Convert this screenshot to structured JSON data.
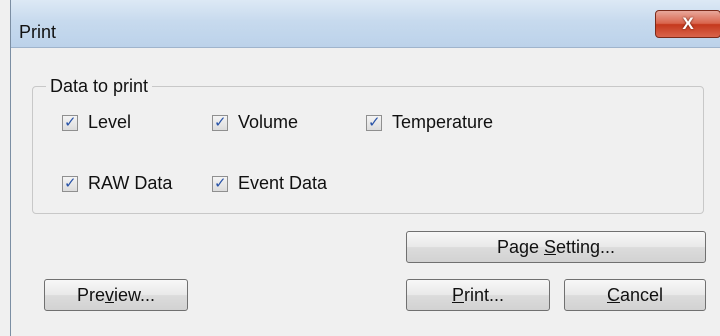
{
  "window": {
    "title": "Print",
    "close_label": "X"
  },
  "group": {
    "legend": "Data to print",
    "checkboxes": [
      {
        "label": "Level",
        "checked": true
      },
      {
        "label": "Volume",
        "checked": true
      },
      {
        "label": "Temperature",
        "checked": true
      },
      {
        "label": "RAW Data",
        "checked": true
      },
      {
        "label": "Event Data",
        "checked": true
      }
    ]
  },
  "buttons": {
    "page_setting": {
      "pre": "Page ",
      "mnemonic": "S",
      "post": "etting..."
    },
    "preview": {
      "pre": "Pre",
      "mnemonic": "v",
      "post": "iew..."
    },
    "print": {
      "pre": "",
      "mnemonic": "P",
      "post": "rint..."
    },
    "cancel": {
      "pre": "",
      "mnemonic": "C",
      "post": "ancel"
    }
  },
  "colors": {
    "titlebar": "#c7daee",
    "close_button": "#c4381c",
    "check_mark": "#2a54a8",
    "window_bg": "#f0f0f0"
  }
}
